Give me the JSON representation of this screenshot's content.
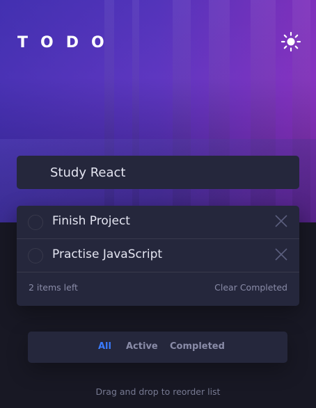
{
  "header": {
    "logo": "TODO",
    "theme_icon": "sun-icon"
  },
  "new_todo": {
    "value": "Study React"
  },
  "todos": [
    {
      "label": "Finish Project",
      "completed": false
    },
    {
      "label": "Practise JavaScript",
      "completed": false
    }
  ],
  "footer": {
    "items_left": "2 items left",
    "clear_label": "Clear Completed"
  },
  "filters": [
    {
      "label": "All",
      "active": true
    },
    {
      "label": "Active",
      "active": false
    },
    {
      "label": "Completed",
      "active": false
    }
  ],
  "hint": "Drag and drop to reorder list",
  "colors": {
    "accent": "#3a7bfd",
    "card": "#25273c",
    "background": "#181824"
  }
}
